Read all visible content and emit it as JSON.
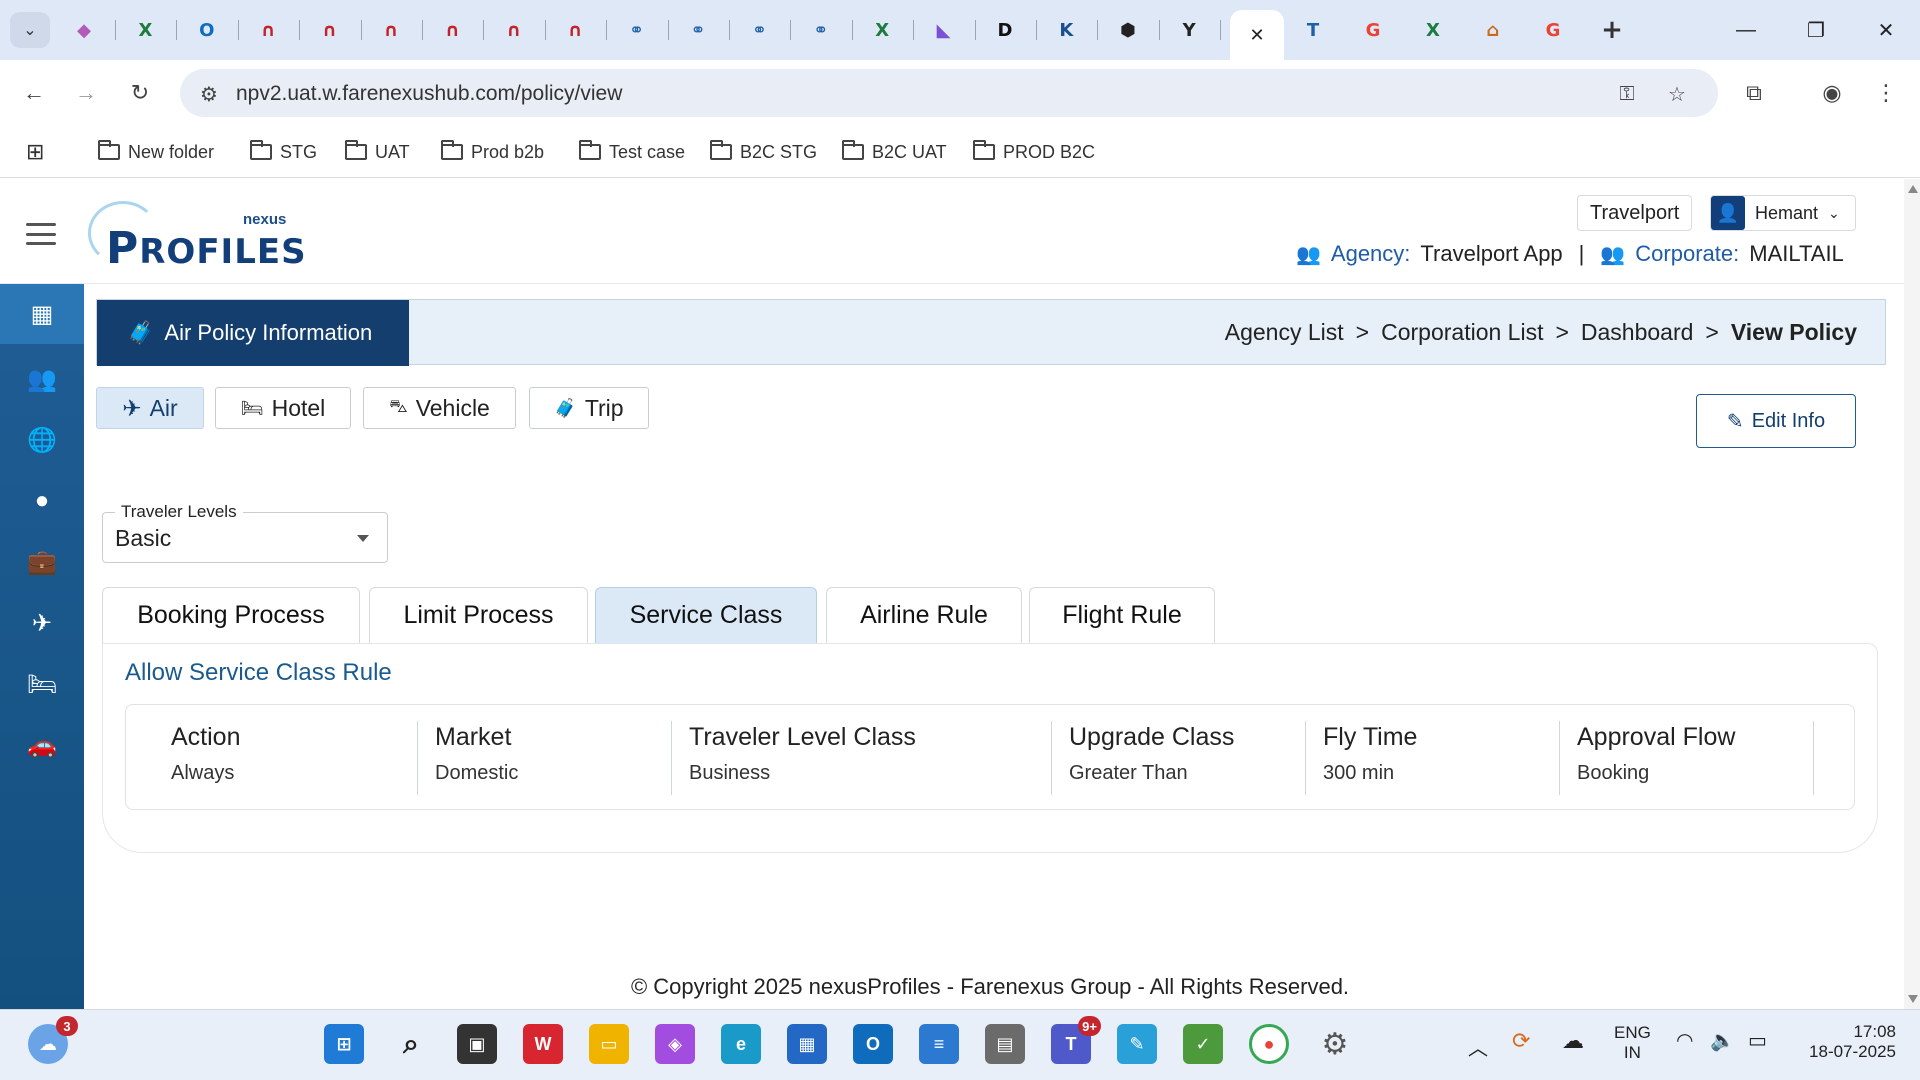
{
  "browser": {
    "url": "npv2.uat.w.farenexushub.com/policy/view",
    "tabs": [
      {
        "glyph": "◆",
        "color": "#b45ab8"
      },
      {
        "glyph": "X",
        "color": "#1e7b3f"
      },
      {
        "glyph": "O",
        "color": "#0f6cbd"
      },
      {
        "glyph": "∩",
        "color": "#c3242a"
      },
      {
        "glyph": "∩",
        "color": "#c3242a"
      },
      {
        "glyph": "∩",
        "color": "#c3242a"
      },
      {
        "glyph": "∩",
        "color": "#c3242a"
      },
      {
        "glyph": "∩",
        "color": "#c3242a"
      },
      {
        "glyph": "∩",
        "color": "#c3242a"
      },
      {
        "glyph": "⚭",
        "color": "#1d5fa8"
      },
      {
        "glyph": "⚭",
        "color": "#1d5fa8"
      },
      {
        "glyph": "⚭",
        "color": "#1d5fa8"
      },
      {
        "glyph": "⚭",
        "color": "#1d5fa8"
      },
      {
        "glyph": "X",
        "color": "#1e7b3f"
      },
      {
        "glyph": "◣",
        "color": "#7b4fd6"
      },
      {
        "glyph": "D",
        "color": "#111111"
      },
      {
        "glyph": "K",
        "color": "#1a4f8f"
      },
      {
        "glyph": "⬢",
        "color": "#222222"
      },
      {
        "glyph": "Y",
        "color": "#222222"
      }
    ],
    "tabs_after": [
      {
        "glyph": "T",
        "color": "#1d5fa8"
      },
      {
        "glyph": "G",
        "color": "#ea4335"
      },
      {
        "glyph": "X",
        "color": "#1e7b3f"
      },
      {
        "glyph": "⌂",
        "color": "#c96b1a"
      },
      {
        "glyph": "G",
        "color": "#ea4335"
      }
    ],
    "active_tab_close": "✕",
    "new_tab": "+",
    "bookmarks": [
      "New folder",
      "STG",
      "UAT",
      "Prod b2b",
      "Test case",
      "B2C STG",
      "B2C UAT",
      "PROD B2C"
    ]
  },
  "header": {
    "logo_small": "nexus",
    "logo_main_p": "P",
    "logo_main_rest": "ROFILES",
    "provider_button": "Travelport",
    "user_name": "Hemant",
    "agency_label": "Agency:",
    "agency_value": "Travelport App",
    "separator": "|",
    "corporate_label": "Corporate:",
    "corporate_value": "MAILTAIL"
  },
  "panel": {
    "title": "Air Policy Information",
    "breadcrumbs": [
      "Agency List",
      "Corporation List",
      "Dashboard"
    ],
    "breadcrumb_current": "View Policy",
    "breadcrumb_sep": ">"
  },
  "type_tabs": [
    {
      "label": "Air",
      "icon": "✈"
    },
    {
      "label": "Hotel",
      "icon": "🛏"
    },
    {
      "label": "Vehicle",
      "icon": "⛍"
    },
    {
      "label": "Trip",
      "icon": "🧳"
    }
  ],
  "edit_button": "Edit Info",
  "traveler_levels": {
    "label": "Traveler Levels",
    "value": "Basic"
  },
  "rule_tabs": [
    "Booking Process",
    "Limit Process",
    "Service Class",
    "Airline Rule",
    "Flight Rule"
  ],
  "active_rule_tab": "Service Class",
  "service_class_rule": {
    "title": "Allow Service Class Rule",
    "columns": [
      {
        "header": "Action",
        "value": "Always"
      },
      {
        "header": "Market",
        "value": "Domestic"
      },
      {
        "header": "Traveler Level Class",
        "value": "Business"
      },
      {
        "header": "Upgrade Class",
        "value": "Greater Than"
      },
      {
        "header": "Fly Time",
        "value": "300 min"
      },
      {
        "header": "Approval Flow",
        "value": "Booking"
      }
    ]
  },
  "footer": {
    "copyright": "© Copyright 2025 nexusProfiles - Farenexus Group - All Rights Reserved."
  },
  "taskbar": {
    "weather_badge": "3",
    "teams_badge": "9+",
    "lang_1": "ENG",
    "lang_2": "IN",
    "time": "17:08",
    "date": "18-07-2025"
  },
  "colors": {
    "brand_dark": "#143e6e",
    "sidebar": "#1f5d95",
    "accent_blue": "#1f5ba8",
    "active_tab_bg": "#dbe9f7"
  }
}
